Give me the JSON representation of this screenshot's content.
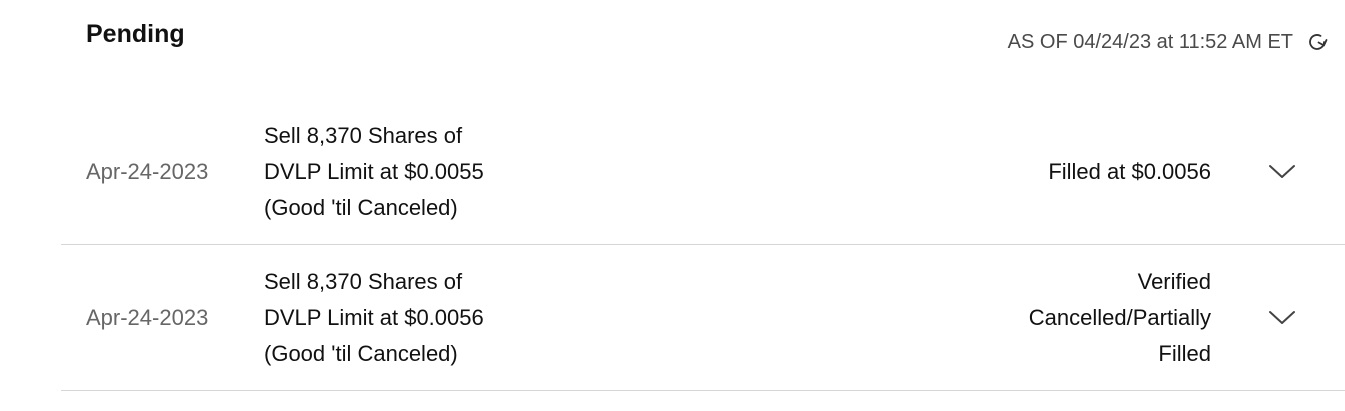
{
  "section": {
    "title": "Pending",
    "as_of": "AS OF 04/24/23 at 11:52 AM ET"
  },
  "icons": {
    "refresh": "refresh-icon",
    "expand": "chevron-down-icon"
  },
  "orders": [
    {
      "date": "Apr-24-2023",
      "description": [
        "Sell 8,370 Shares of",
        "DVLP Limit at $0.0055",
        "(Good 'til Canceled)"
      ],
      "status": [
        "Filled at $0.0056"
      ]
    },
    {
      "date": "Apr-24-2023",
      "description": [
        "Sell 8,370 Shares of",
        "DVLP Limit at $0.0056",
        "(Good 'til Canceled)"
      ],
      "status": [
        "Verified",
        "Cancelled/Partially",
        "Filled"
      ]
    }
  ]
}
